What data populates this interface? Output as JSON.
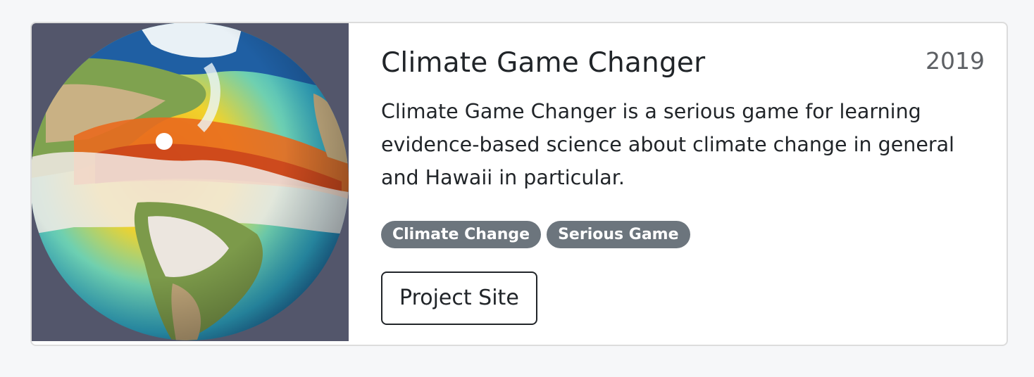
{
  "project": {
    "title": "Climate Game Changer",
    "year": "2019",
    "description": "Climate Game Changer is a serious game for learning evidence-based science about climate change in general and Hawaii in particular.",
    "tags": [
      "Climate Change",
      "Serious Game"
    ],
    "link_label": "Project Site",
    "image_alt": "Globe showing ocean temperature and clouds over the Americas"
  },
  "colors": {
    "tag_bg": "#6c757d",
    "thumb_bg": "#53566b",
    "text": "#212529"
  }
}
